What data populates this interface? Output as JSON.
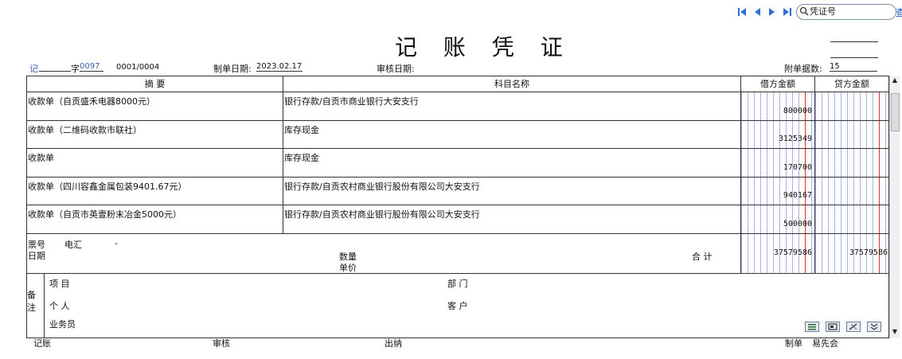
{
  "nav": {
    "search_value": "凭证号",
    "query_label": "查"
  },
  "voucher": {
    "title": "记 账 凭 证",
    "type_char": "记",
    "word_label": "字",
    "voucher_no": "0097",
    "page_info": "0001/0004",
    "made_date_label": "制单日期:",
    "made_date": "2023.02.17",
    "audit_date_label": "审核日期:",
    "audit_date": "",
    "attach_label": "附单据数:",
    "attach_count": "15"
  },
  "table": {
    "headers": {
      "summary": "摘 要",
      "account": "科目名称",
      "debit": "借方金额",
      "credit": "贷方金额"
    },
    "rows": [
      {
        "summary": "收款单（自贡盛禾电器8000元）",
        "account": "银行存款/自贡市商业银行大安支行",
        "debit": "800000",
        "credit": ""
      },
      {
        "summary": "收款单（二维码收款市联社）",
        "account": "库存现金",
        "debit": "3125349",
        "credit": ""
      },
      {
        "summary": "收款单",
        "account": "库存现金",
        "debit": "170700",
        "credit": ""
      },
      {
        "summary": "收款单（四川容鑫金属包装9401.67元）",
        "account": "银行存款/自贡农村商业银行股份有限公司大安支行",
        "debit": "940167",
        "credit": ""
      },
      {
        "summary": "收款单（自贡市英壹粉末冶金5000元）",
        "account": "银行存款/自贡农村商业银行股份有限公司大安支行",
        "debit": "500000",
        "credit": ""
      }
    ],
    "footer": {
      "ticket_label": "票号",
      "ticket_value": "电汇",
      "ticket_dash": "-",
      "date_label": "日期",
      "qty_label": "数量",
      "price_label": "单价",
      "total_label": "合 计",
      "total_debit": "37579586",
      "total_credit": "37579586"
    }
  },
  "remarks": {
    "label": "备注",
    "project_label": "项 目",
    "dept_label": "部 门",
    "person_label": "个 人",
    "customer_label": "客 户",
    "salesman_label": "业务员"
  },
  "signatures": {
    "bookkeep_label": "记账",
    "audit_label": "审核",
    "cashier_label": "出纳",
    "maker_label": "制单",
    "maker_name": "易先会"
  }
}
